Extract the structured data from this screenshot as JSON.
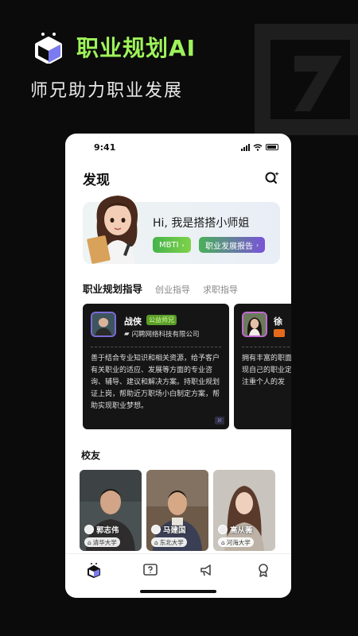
{
  "promo": {
    "title": "职业规划AI",
    "subtitle": "师兄助力职业发展"
  },
  "status_bar": {
    "time": "9:41"
  },
  "header": {
    "title": "发现"
  },
  "banner": {
    "greeting": "Hi, 我是搭搭小师姐",
    "mbti_label": "MBTI",
    "report_label": "职业发展报告"
  },
  "tabs": [
    {
      "label": "职业规划指导",
      "active": true
    },
    {
      "label": "创业指导",
      "active": false
    },
    {
      "label": "求职指导",
      "active": false
    }
  ],
  "mentors": [
    {
      "name": "战侠",
      "badge": "公益师兄",
      "company": "闪聘网络科技有限公司",
      "description": "善于结合专业知识和相关资源，给予客户有关职业的适应、发展等方面的专业咨询、辅导、建议和解决方案。持职业规划证上岗，帮助近万职场小白制定方案，帮助实现职业梦想。"
    },
    {
      "name": "徐",
      "description": "拥有丰富的职面的知识和相现自己的职业定实现职业目注重个人的发"
    }
  ],
  "alumni_section": {
    "title": "校友"
  },
  "alumni": [
    {
      "name": "郭志伟",
      "school": "清华大学"
    },
    {
      "name": "马建国",
      "school": "东北大学"
    },
    {
      "name": "高从薇",
      "school": "河海大学"
    }
  ],
  "bottom_nav": [
    {
      "icon": "cube-icon",
      "active": true
    },
    {
      "icon": "question-icon",
      "active": false
    },
    {
      "icon": "megaphone-icon",
      "active": false
    },
    {
      "icon": "medal-icon",
      "active": false
    }
  ],
  "colors": {
    "accent": "#9ef35a",
    "background": "#0b0b0b",
    "card": "#151515"
  }
}
